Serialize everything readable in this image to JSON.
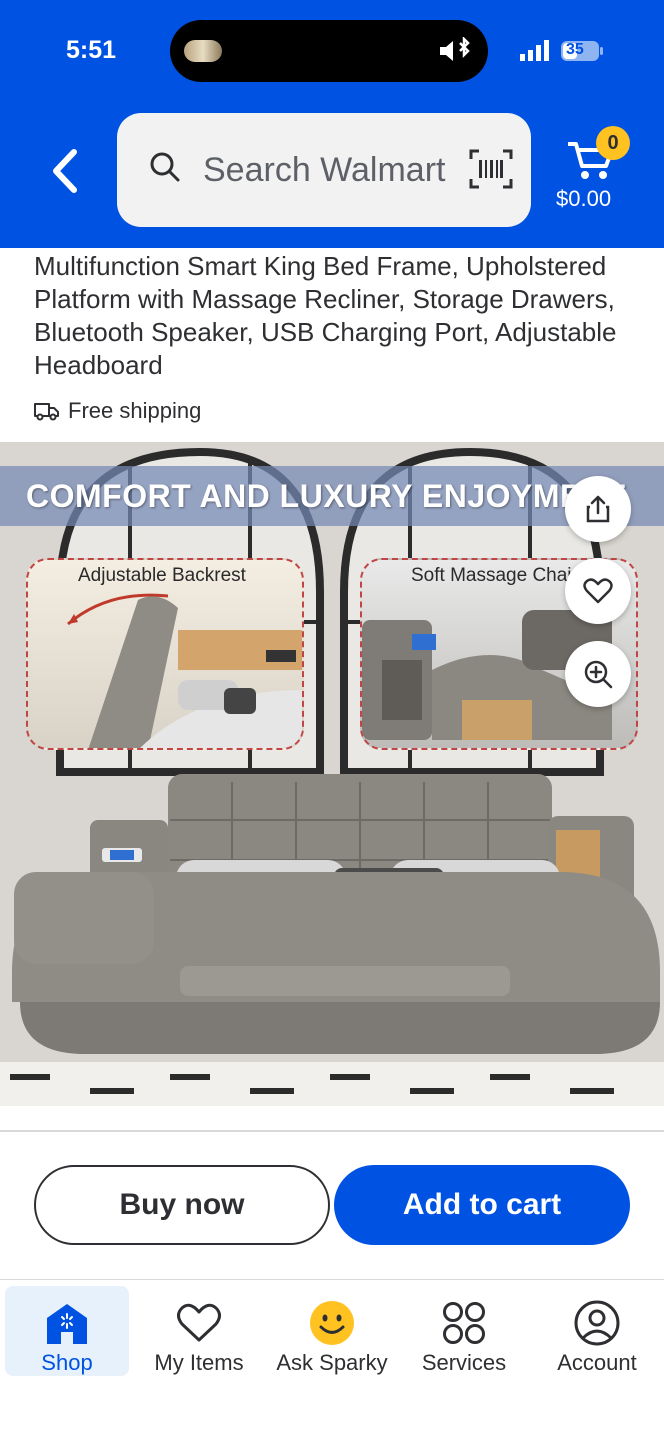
{
  "status_bar": {
    "time": "5:51",
    "battery": "35"
  },
  "header": {
    "search_placeholder": "Search Walmart",
    "cart_count": "0",
    "cart_total": "$0.00"
  },
  "product": {
    "title": "Multifunction Smart King Bed Frame, Upholstered Platform with Massage Recliner, Storage Drawers, Bluetooth Speaker, USB Charging Port, Adjustable Headboard",
    "shipping": "Free shipping",
    "image": {
      "banner_text": "COMFORT AND LUXURY ENJOYMENT",
      "inset_left_label": "Adjustable Backrest",
      "inset_right_label": "Soft Massage Chair"
    }
  },
  "actions": {
    "buy_now": "Buy now",
    "add_to_cart": "Add to cart"
  },
  "bottom_nav": {
    "items": [
      {
        "label": "Shop",
        "icon": "shop-icon",
        "active": true
      },
      {
        "label": "My Items",
        "icon": "heart-icon",
        "active": false
      },
      {
        "label": "Ask Sparky",
        "icon": "sparky-icon",
        "active": false
      },
      {
        "label": "Services",
        "icon": "services-icon",
        "active": false
      },
      {
        "label": "Account",
        "icon": "account-icon",
        "active": false
      }
    ]
  },
  "colors": {
    "brand_blue": "#0053e2",
    "spark_yellow": "#ffc220"
  }
}
